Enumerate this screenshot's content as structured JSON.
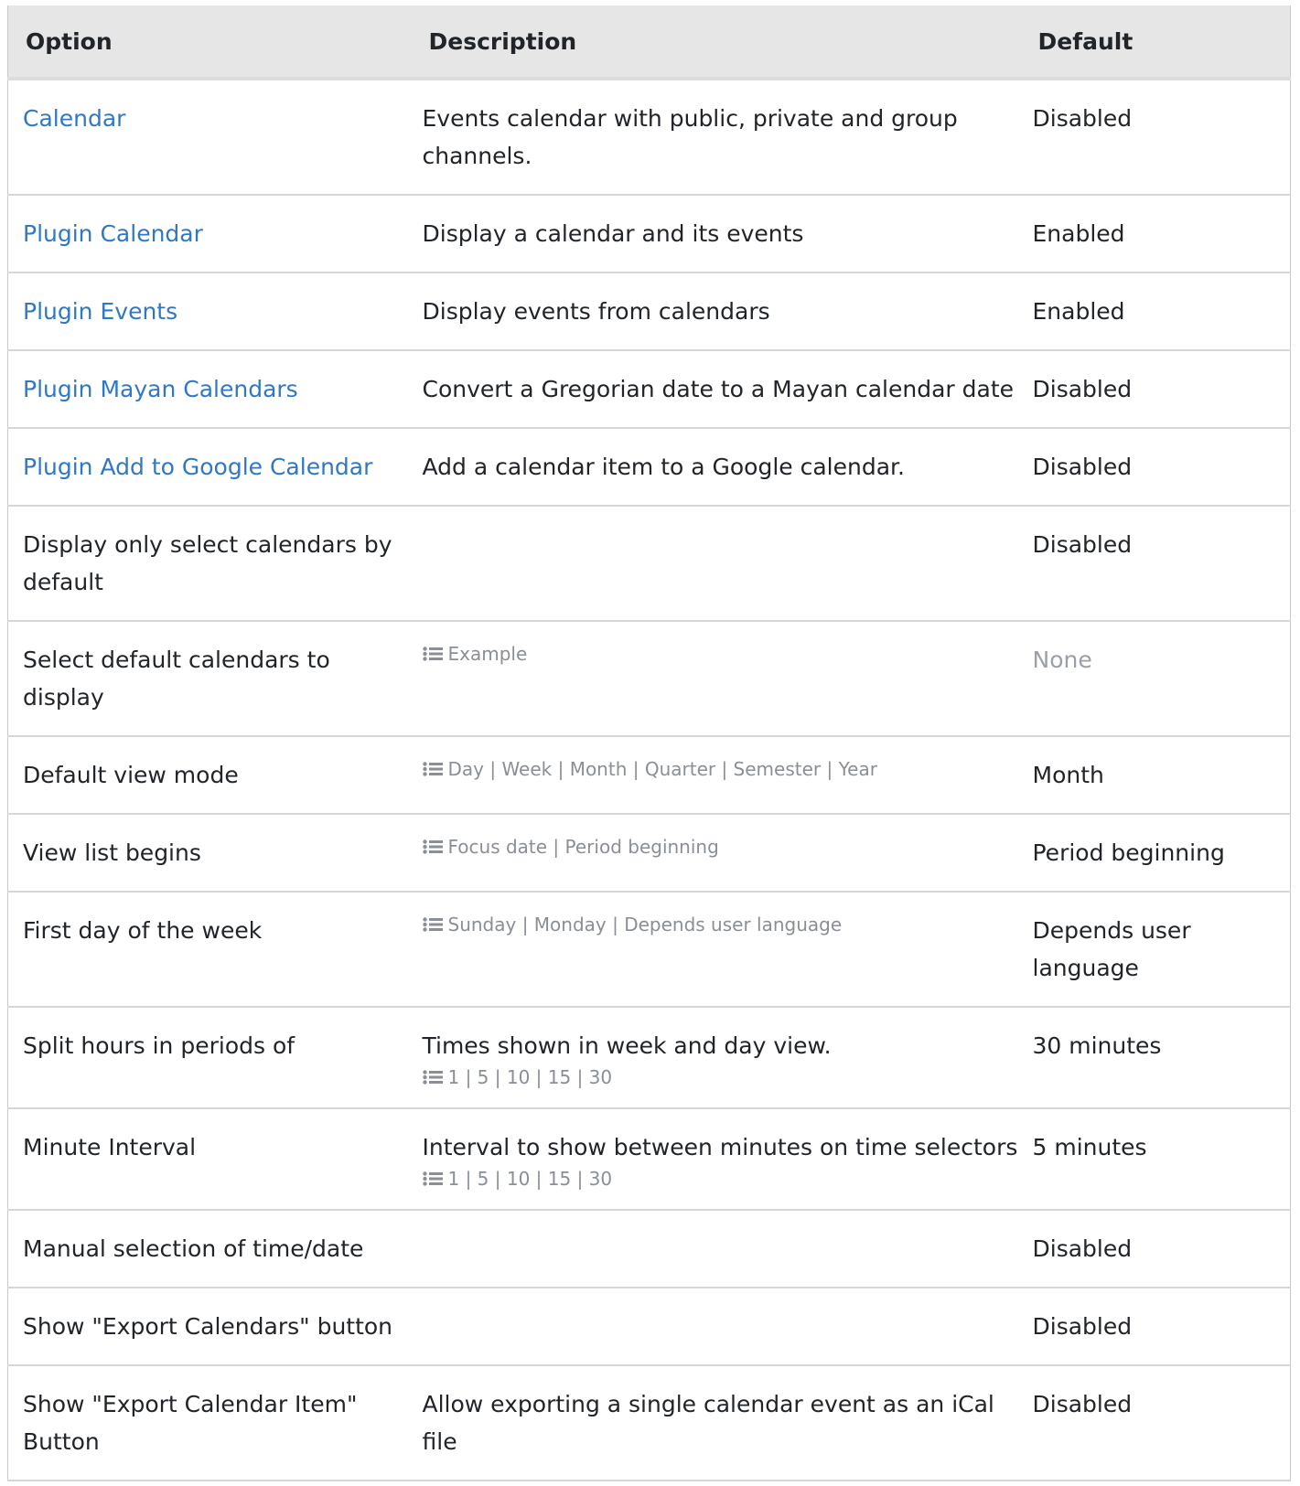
{
  "table": {
    "headers": {
      "option": "Option",
      "description": "Description",
      "default": "Default"
    },
    "rows": [
      {
        "option": "Calendar",
        "option_is_link": true,
        "description": "Events calendar with public, private and group channels.",
        "options_list": "",
        "default": "Disabled"
      },
      {
        "option": "Plugin Calendar",
        "option_is_link": true,
        "description": "Display a calendar and its events",
        "options_list": "",
        "default": "Enabled"
      },
      {
        "option": "Plugin Events",
        "option_is_link": true,
        "description": "Display events from calendars",
        "options_list": "",
        "default": "Enabled"
      },
      {
        "option": "Plugin Mayan Calendars",
        "option_is_link": true,
        "description": "Convert a Gregorian date to a Mayan calendar date",
        "options_list": "",
        "default": "Disabled"
      },
      {
        "option": "Plugin Add to Google Calendar",
        "option_is_link": true,
        "description": "Add a calendar item to a Google calendar.",
        "options_list": "",
        "default": "Disabled"
      },
      {
        "option": "Display only select calendars by default",
        "option_is_link": false,
        "description": "",
        "options_list": "",
        "default": "Disabled"
      },
      {
        "option": "Select default calendars to display",
        "option_is_link": false,
        "description": "",
        "options_list": "Example",
        "default": "None",
        "default_muted": true
      },
      {
        "option": "Default view mode",
        "option_is_link": false,
        "description": "",
        "options_list": "Day | Week | Month | Quarter | Semester | Year",
        "default": "Month"
      },
      {
        "option": "View list begins",
        "option_is_link": false,
        "description": "",
        "options_list": "Focus date | Period beginning",
        "default": "Period beginning"
      },
      {
        "option": "First day of the week",
        "option_is_link": false,
        "description": "",
        "options_list": "Sunday | Monday | Depends user language",
        "default": "Depends user language"
      },
      {
        "option": "Split hours in periods of",
        "option_is_link": false,
        "description": "Times shown in week and day view.",
        "options_list": "1 | 5 | 10 | 15 | 30",
        "default": "30 minutes"
      },
      {
        "option": "Minute Interval",
        "option_is_link": false,
        "description": "Interval to show between minutes on time selectors",
        "options_list": "1 | 5 | 10 | 15 | 30",
        "default": "5 minutes"
      },
      {
        "option": "Manual selection of time/date",
        "option_is_link": false,
        "description": "",
        "options_list": "",
        "default": "Disabled"
      },
      {
        "option": "Show \"Export Calendars\" button",
        "option_is_link": false,
        "description": "",
        "options_list": "",
        "default": "Disabled"
      },
      {
        "option": "Show \"Export Calendar Item\" Button",
        "option_is_link": false,
        "description": "Allow exporting a single calendar event as an iCal file",
        "options_list": "",
        "default": "Disabled"
      }
    ]
  },
  "icons": {
    "options_list": "list-icon"
  },
  "colors": {
    "header_bg": "#e6e6e6",
    "link": "#3078c4",
    "muted_text": "#8a8f96",
    "row_border": "#d6d6d6"
  }
}
